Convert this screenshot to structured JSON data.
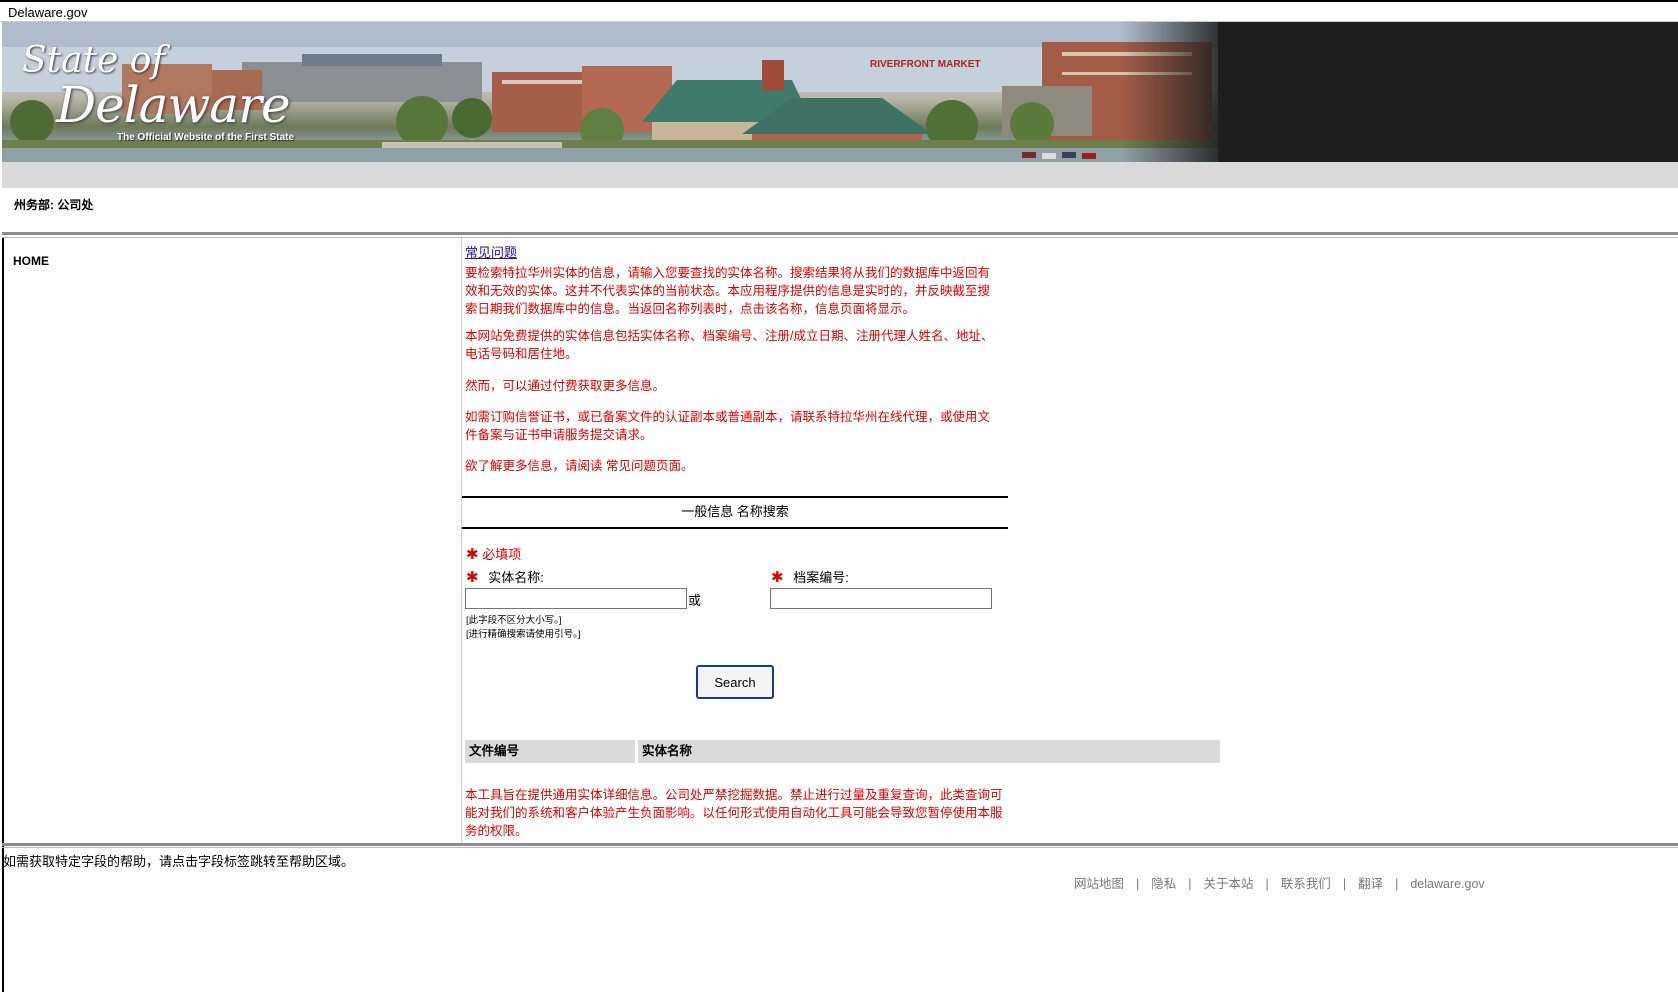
{
  "window": {
    "title": "Delaware.gov"
  },
  "banner": {
    "logo_state": "State of",
    "logo_delaware": "Delaware",
    "logo_tagline": "The Official Website of the First State",
    "market_sign": "RIVERFRONT MARKET"
  },
  "dept": {
    "label": "州务部:  公司处"
  },
  "nav": {
    "home": "HOME"
  },
  "content": {
    "faq_link": "常见问题",
    "paragraphs": [
      "要检索特拉华州实体的信息，请输入您要查找的实体名称。搜索结果将从我们的数据库中返回有效和无效的实体。这并不代表实体的当前状态。本应用程序提供的信息是实时的，并反映截至搜索日期我们数据库中的信息。当返回名称列表时，点击该名称，信息页面将显示。",
      "本网站免费提供的实体信息包括实体名称、档案编号、注册/成立日期、注册代理人姓名、地址、电话号码和居住地。",
      "然而，可以通过付费获取更多信息。",
      "如需订购信誉证书，或已备案文件的认证副本或普通副本，请联系特拉华州在线代理，或使用文件备案与证书申请服务提交请求。",
      "欲了解更多信息，请阅读 常见问题页面。"
    ],
    "section_title": "一般信息 名称搜索",
    "required_note": "必填项",
    "required_star": "✱",
    "entity_name_label": "实体名称:",
    "entity_name_value": "",
    "or_text": "或",
    "file_number_label": "档案编号:",
    "file_number_value": "",
    "hint_case": "[此字段不区分大小写。]",
    "hint_quotes": "[进行精确搜索请使用引号。]",
    "search_button": "Search",
    "results_headers": [
      "文件编号",
      "实体名称"
    ],
    "disclaimer": "本工具旨在提供通用实体详细信息。公司处严禁挖掘数据。禁止进行过量及重复查询，此类查询可能对我们的系统和客户体验产生负面影响。以任何形式使用自动化工具可能会导致您暂停使用本服务的权限。"
  },
  "help_text": "如需获取特定字段的帮助，请点击字段标签跳转至帮助区域。",
  "footer": {
    "links": [
      "网站地图",
      "隐私",
      "关于本站",
      "联系我们",
      "翻译",
      "delaware.gov"
    ],
    "separator": "|"
  }
}
